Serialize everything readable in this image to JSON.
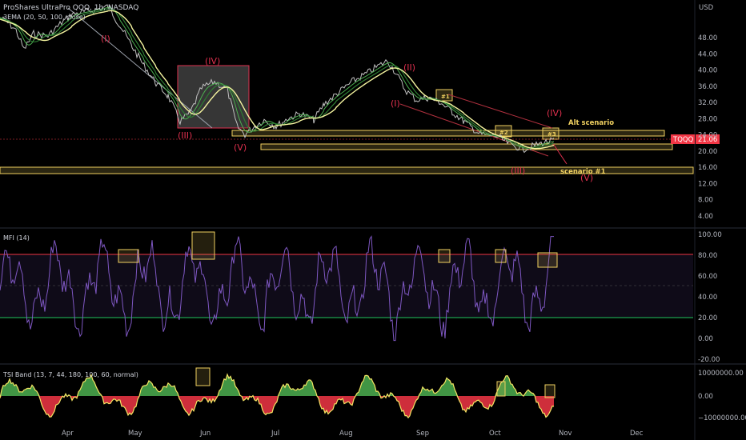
{
  "header": {
    "symbol_title": "ProShares UltraPro QQQ, 1h, NASDAQ",
    "ma_label": "3EMA (20, 50, 100, close)",
    "currency": "USD"
  },
  "price_tag": {
    "ticker": "TQQQ",
    "value": "21.06"
  },
  "panes": {
    "mfi": {
      "title": "MFI (14)"
    },
    "tsi": {
      "title": "TSI Band (13, 7, 44, 180, 100, 60, normal)"
    }
  },
  "x_axis": {
    "months": [
      "Apr",
      "May",
      "Jun",
      "Jul",
      "Aug",
      "Sep",
      "Oct",
      "Nov",
      "Dec"
    ]
  },
  "waves": {
    "i1": "(I)",
    "iii1": "(III)",
    "iv1": "(IV)",
    "v1": "(V)",
    "ii2": "(II)",
    "i2": "(I)",
    "iii2": "(III)",
    "iv2": "(IV)",
    "v2": "(V)"
  },
  "annotations": {
    "alt": "Alt scenario",
    "s1": "scenario #1",
    "box1": "#1",
    "box2": "#2",
    "box3": "#3"
  },
  "colors": {
    "background": "#000000",
    "price_line": "#c0c0c0",
    "ema_fast": "#4caf50",
    "ema_mid": "#2e7d32",
    "ema_slow": "#f5f5a0",
    "wave_label": "#e0304e",
    "annotation": "#f0d060",
    "mfi_line": "#7e57c2",
    "mfi_upper": "#f23645",
    "mfi_lower": "#22c55e",
    "tsi_pos": "#4caf50",
    "tsi_neg": "#f23645",
    "tsi_line": "#f5e663",
    "price_tag_bg": "#f23645"
  },
  "chart_data": [
    {
      "type": "line",
      "name": "price",
      "y_axis_ticks": [
        "48.00",
        "44.00",
        "40.00",
        "36.00",
        "32.00",
        "28.00",
        "24.00",
        "20.00",
        "16.00",
        "12.00",
        "8.00",
        "4.00"
      ],
      "ylim": [
        0,
        52
      ],
      "x": [
        "Apr",
        "May",
        "Jun",
        "Jul",
        "Aug",
        "Sep",
        "Oct",
        "Nov"
      ],
      "series": [
        {
          "name": "TQQQ",
          "values": [
            46.5,
            35,
            29,
            24.5,
            39,
            28,
            19,
            21.06
          ]
        }
      ]
    },
    {
      "type": "line",
      "name": "MFI (14)",
      "y_axis_ticks": [
        "100.00",
        "80.00",
        "60.00",
        "40.00",
        "20.00",
        "0.00",
        "-20.00"
      ],
      "ylim": [
        -20,
        100
      ],
      "upper_band": 80,
      "lower_band": 20
    },
    {
      "type": "area",
      "name": "TSI Band",
      "y_axis_ticks": [
        "10000000.00",
        "0.00",
        "−10000000.00"
      ],
      "ylim": [
        -12000000,
        12000000
      ]
    }
  ]
}
